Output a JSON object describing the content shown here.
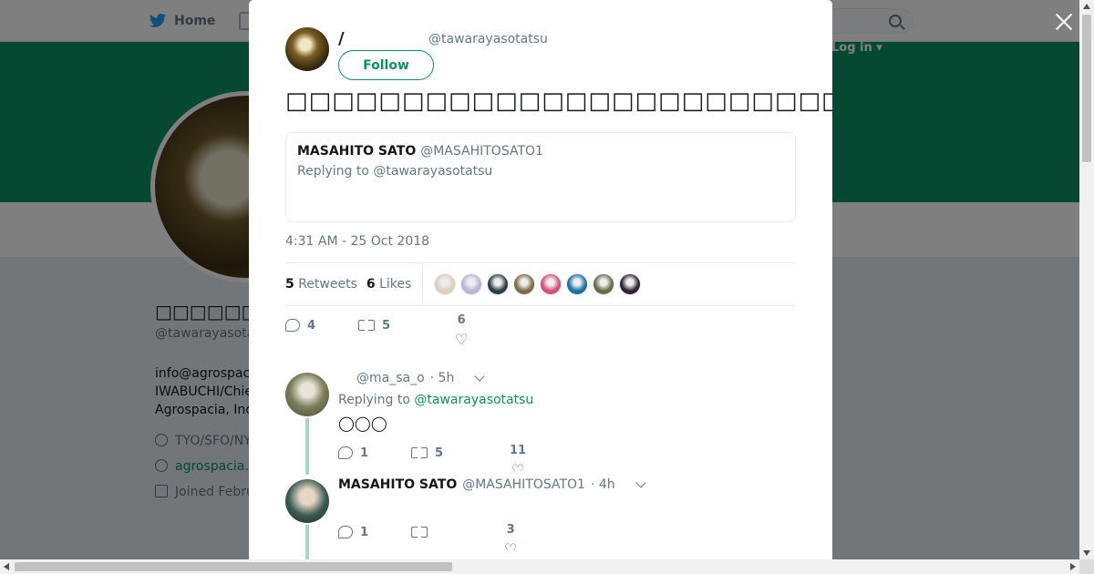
{
  "topbar": {
    "home_label": "Home",
    "login_label": "Log in ▾"
  },
  "profile": {
    "name": "□□□□□□□□",
    "handle": "@tawarayasotatsu",
    "bio_lines": [
      "info@agrospacia.com",
      "IWABUCHI/Chief",
      "Agrospacia, Inc."
    ],
    "location": "TYO/SFO/NYC",
    "website": "agrospacia.com",
    "joined": "Joined February"
  },
  "tweet": {
    "author_name": "/",
    "author_handle": "@tawarayasotatsu",
    "follow_label": "Follow",
    "text": "□□□□□□□□□□□□□□□□□□□□□□□□□□□□□□□□□□□□□…□□□□□□□□□□□□□□□",
    "quote": {
      "name": "MASAHITO SATO",
      "handle": "@MASAHITOSATO1",
      "replying": "Replying to @tawarayasotatsu"
    },
    "timestamp": "4:31 AM - 25 Oct 2018",
    "retweets_count": "5",
    "retweets_label": "Retweets",
    "likes_count": "6",
    "likes_label": "Likes",
    "liker_colors": [
      "#d9cfc0",
      "#b8b5d6",
      "#2f3e44",
      "#7d6b4b",
      "#d4507a",
      "#1d6fa3",
      "#6b6b4a",
      "#2c2230"
    ],
    "actions": {
      "reply": "4",
      "retweet": "5",
      "like": "6"
    }
  },
  "replies": [
    {
      "name": "",
      "handle": "@ma_sa_o",
      "time": "· 5h",
      "replying_prefix": "Replying to",
      "replying_to": "@tawarayasotatsu",
      "text": "◯◯◯",
      "actions": {
        "reply": "1",
        "retweet": "5",
        "like": "11"
      },
      "avatar_color": "#7c7f5a"
    },
    {
      "name": "MASAHITO SATO",
      "handle": "@MASAHITOSATO1",
      "time": "· 4h",
      "actions": {
        "reply": "1",
        "retweet": "",
        "like": "3"
      },
      "avatar_color": "#3b5a52"
    }
  ]
}
